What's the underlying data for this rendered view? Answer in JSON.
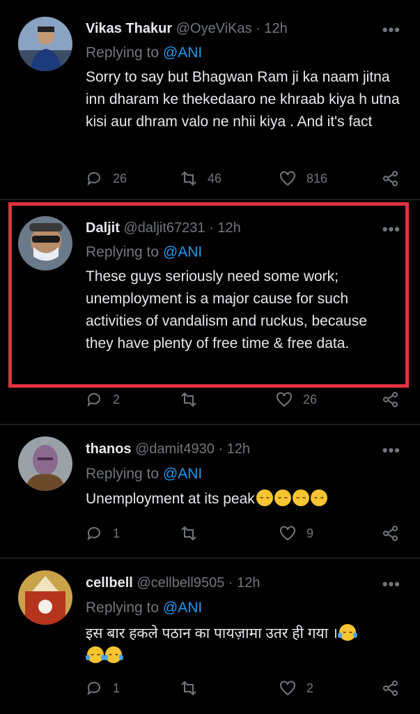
{
  "tweets": [
    {
      "name": "Vikas Thakur",
      "handle": "@OyeViKas",
      "time": "12h",
      "replying_label": "Replying to",
      "replying_to": "@ANI",
      "text": "Sorry to say but Bhagwan Ram ji ka naam jitna inn dharam ke thekedaaro ne khraab kiya h utna kisi aur dhram valo ne nhii kiya . And it's fact",
      "replies": "26",
      "retweets": "46",
      "likes": "816"
    },
    {
      "name": "Daljit",
      "handle": "@daljit67231",
      "time": "12h",
      "replying_label": "Replying to",
      "replying_to": "@ANI",
      "text": "These guys seriously need some work; unemployment is a major cause for such activities of vandalism and ruckus, because they have plenty of free time & free data.",
      "replies": "2",
      "retweets": "",
      "likes": "26"
    },
    {
      "name": "thanos",
      "handle": "@damit4930",
      "time": "12h",
      "replying_label": "Replying to",
      "replying_to": "@ANI",
      "text": "Unemployment at its peak",
      "replies": "1",
      "retweets": "",
      "likes": "9"
    },
    {
      "name": "cellbell",
      "handle": "@cellbell9505",
      "time": "12h",
      "replying_label": "Replying to",
      "replying_to": "@ANI",
      "text": "इस बार हकले पठान का पायज़ामा उतर ही गया ।",
      "replies": "1",
      "retweets": "",
      "likes": "2"
    }
  ],
  "separator": "·",
  "more_label": "•••",
  "colors": {
    "highlight": "#e0323f",
    "link": "#1d9bf0",
    "muted": "#71767b"
  },
  "icons": [
    "reply-icon",
    "retweet-icon",
    "like-icon",
    "share-icon",
    "more-icon"
  ]
}
